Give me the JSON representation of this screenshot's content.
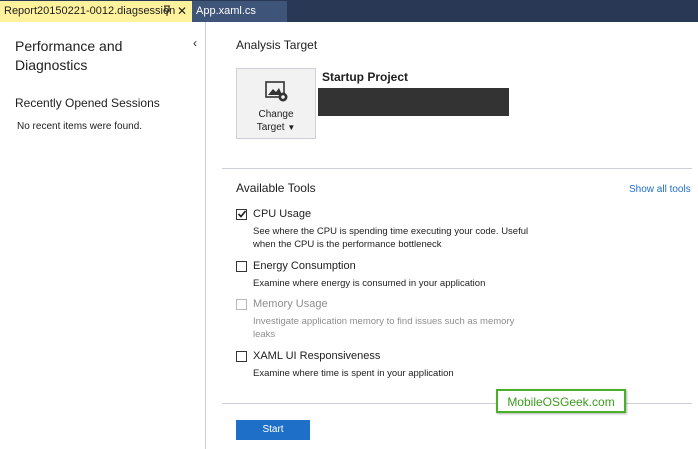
{
  "tabs": [
    {
      "title": "Report20150221-0012.diagsession",
      "active": true
    },
    {
      "title": "App.xaml.cs",
      "active": false
    }
  ],
  "sidebar": {
    "title": "Performance and Diagnostics",
    "recent_title": "Recently Opened Sessions",
    "recent_empty": "No recent items were found."
  },
  "analysis_target": {
    "title": "Analysis Target",
    "change_target_line1": "Change",
    "change_target_line2": "Target",
    "startup_project_label": "Startup Project"
  },
  "available_tools": {
    "title": "Available Tools",
    "show_all": "Show all tools",
    "tools": [
      {
        "name": "CPU Usage",
        "checked": true,
        "enabled": true,
        "description": "See where the CPU is spending time executing your code. Useful when the CPU is the performance bottleneck"
      },
      {
        "name": "Energy Consumption",
        "checked": false,
        "enabled": true,
        "description": "Examine where energy is consumed in your application"
      },
      {
        "name": "Memory Usage",
        "checked": false,
        "enabled": false,
        "description": "Investigate application memory to find issues such as memory leaks"
      },
      {
        "name": "XAML UI Responsiveness",
        "checked": false,
        "enabled": true,
        "description": "Examine where time is spent in your application"
      }
    ]
  },
  "start_button": "Start",
  "watermark": "MobileOSGeek.com",
  "colors": {
    "tab_bar": "#293955",
    "active_tab": "#fff29d",
    "accent_blue": "#1e6fc8",
    "watermark_green": "#4caf2a"
  }
}
